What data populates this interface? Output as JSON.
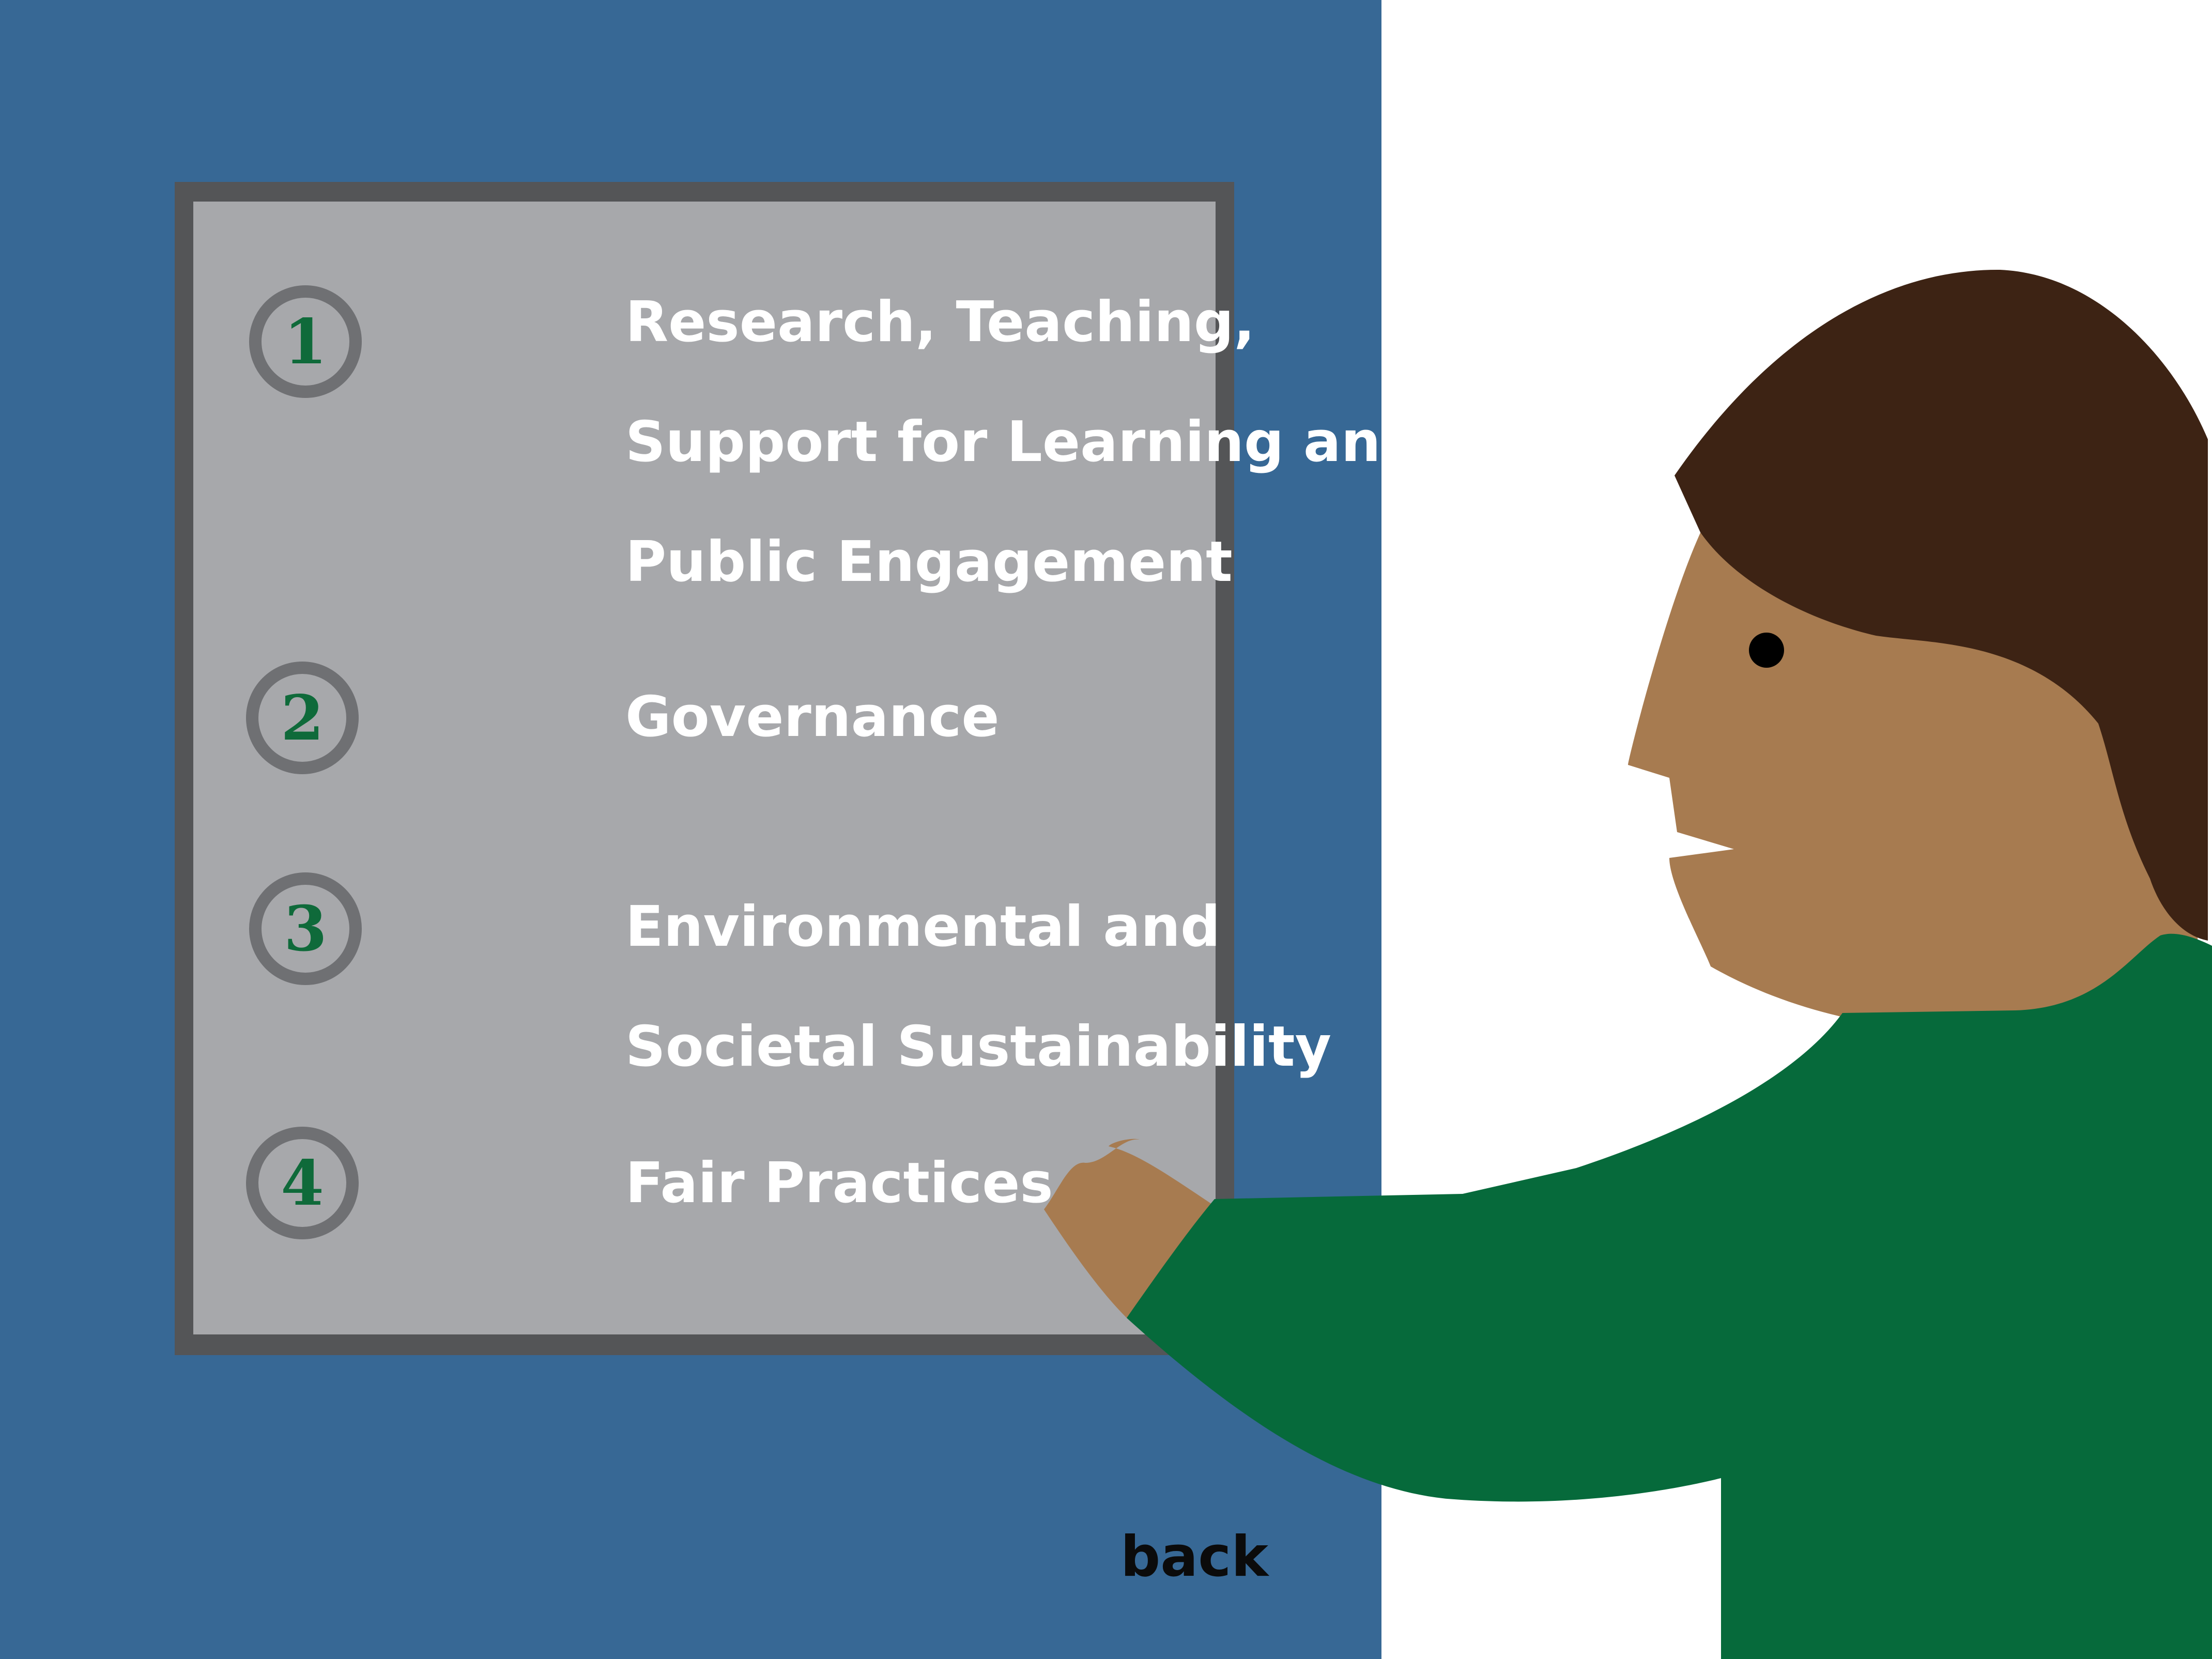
{
  "colors": {
    "panel_blue": "#376895",
    "board_frame": "#545557",
    "board_fill": "#a7a8ab",
    "number_color": "#0f6a3a",
    "item_text": "#ffffff",
    "skin": "#a77b50",
    "hair": "#3d2314",
    "shirt": "#066a3b",
    "back_text": "#0b0b0b"
  },
  "menu": {
    "items": [
      {
        "number": "1",
        "lines": [
          "Research, Teaching,",
          "Support for Learning and",
          "Public Engagement"
        ]
      },
      {
        "number": "2",
        "lines": [
          "Governance"
        ]
      },
      {
        "number": "3",
        "lines": [
          "Environmental and",
          "Societal Sustainability"
        ]
      },
      {
        "number": "4",
        "lines": [
          "Fair Practices"
        ]
      }
    ]
  },
  "nav": {
    "back_label": "back"
  },
  "illustration": {
    "icon": "person-pointing-icon"
  }
}
